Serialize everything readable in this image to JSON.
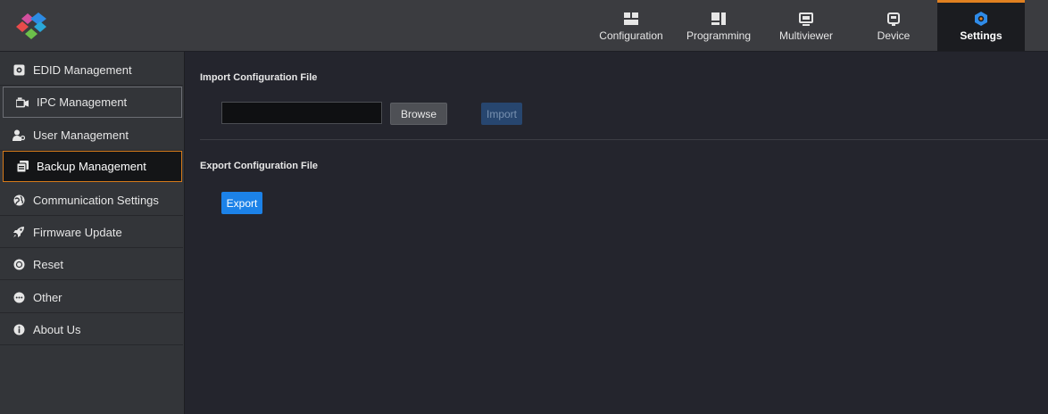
{
  "colors": {
    "accent_orange": "#e08020",
    "primary_blue": "#1c82e8",
    "disabled_blue": "#27466f",
    "background": "#24252d",
    "sidebar_bg": "#333539"
  },
  "header": {
    "logo": "logo-icon",
    "tabs": [
      {
        "label": "Configuration",
        "icon": "configuration-icon"
      },
      {
        "label": "Programming",
        "icon": "programming-icon"
      },
      {
        "label": "Multiviewer",
        "icon": "monitor-icon"
      },
      {
        "label": "Device",
        "icon": "device-icon"
      },
      {
        "label": "Settings",
        "icon": "settings-gear-icon",
        "active": true
      }
    ]
  },
  "sidebar": {
    "items": [
      {
        "label": "EDID Management",
        "icon": "edid-icon"
      },
      {
        "label": "IPC Management",
        "icon": "ipc-icon"
      },
      {
        "label": "User Management",
        "icon": "user-icon"
      },
      {
        "label": "Backup Management",
        "icon": "backup-icon",
        "selected": true
      },
      {
        "label": "Communication Settings",
        "icon": "communication-icon"
      },
      {
        "label": "Firmware Update",
        "icon": "rocket-icon"
      },
      {
        "label": "Reset",
        "icon": "reset-icon"
      },
      {
        "label": "Other",
        "icon": "other-icon"
      },
      {
        "label": "About Us",
        "icon": "info-icon"
      }
    ]
  },
  "main": {
    "import_section": {
      "title": "Import Configuration File",
      "file_value": "",
      "browse_label": "Browse",
      "import_label": "Import"
    },
    "export_section": {
      "title": "Export Configuration File",
      "export_label": "Export"
    }
  }
}
